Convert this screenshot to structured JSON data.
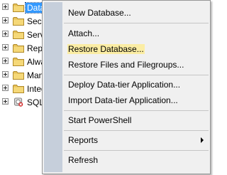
{
  "object_explorer": {
    "nodes": [
      {
        "label": "Datab",
        "icon": "folder-icon",
        "selected": true
      },
      {
        "label": "Secu",
        "icon": "folder-icon",
        "selected": false
      },
      {
        "label": "Serv",
        "icon": "folder-icon",
        "selected": false
      },
      {
        "label": "Repl",
        "icon": "folder-icon",
        "selected": false
      },
      {
        "label": "Alwa",
        "icon": "folder-icon",
        "selected": false
      },
      {
        "label": "Man",
        "icon": "folder-icon",
        "selected": false
      },
      {
        "label": "Integ",
        "icon": "folder-icon",
        "selected": false
      },
      {
        "label": "SQL",
        "icon": "sql-agent-icon",
        "selected": false
      }
    ]
  },
  "context_menu": {
    "items": [
      {
        "label": "New Database..."
      },
      {
        "label": "Attach..."
      },
      {
        "label": "Restore Database...",
        "highlighted": true
      },
      {
        "label": "Restore Files and Filegroups..."
      },
      {
        "label": "Deploy Data-tier Application..."
      },
      {
        "label": "Import Data-tier Application..."
      },
      {
        "label": "Start PowerShell"
      },
      {
        "label": "Reports",
        "has_submenu": true
      },
      {
        "label": "Refresh"
      }
    ]
  },
  "colors": {
    "selection": "#3399ff",
    "menu_background": "#f0f0f0",
    "menu_gutter": "#c6cfdb",
    "highlight": "#fbeda4",
    "folder": "#e8c25a"
  }
}
